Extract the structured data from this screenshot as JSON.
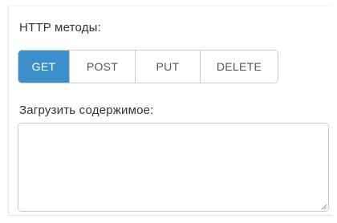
{
  "methods": {
    "label": "HTTP методы:",
    "options": [
      "GET",
      "POST",
      "PUT",
      "DELETE"
    ],
    "selected": "GET"
  },
  "upload": {
    "label": "Загрузить содержимое:",
    "value": ""
  }
}
